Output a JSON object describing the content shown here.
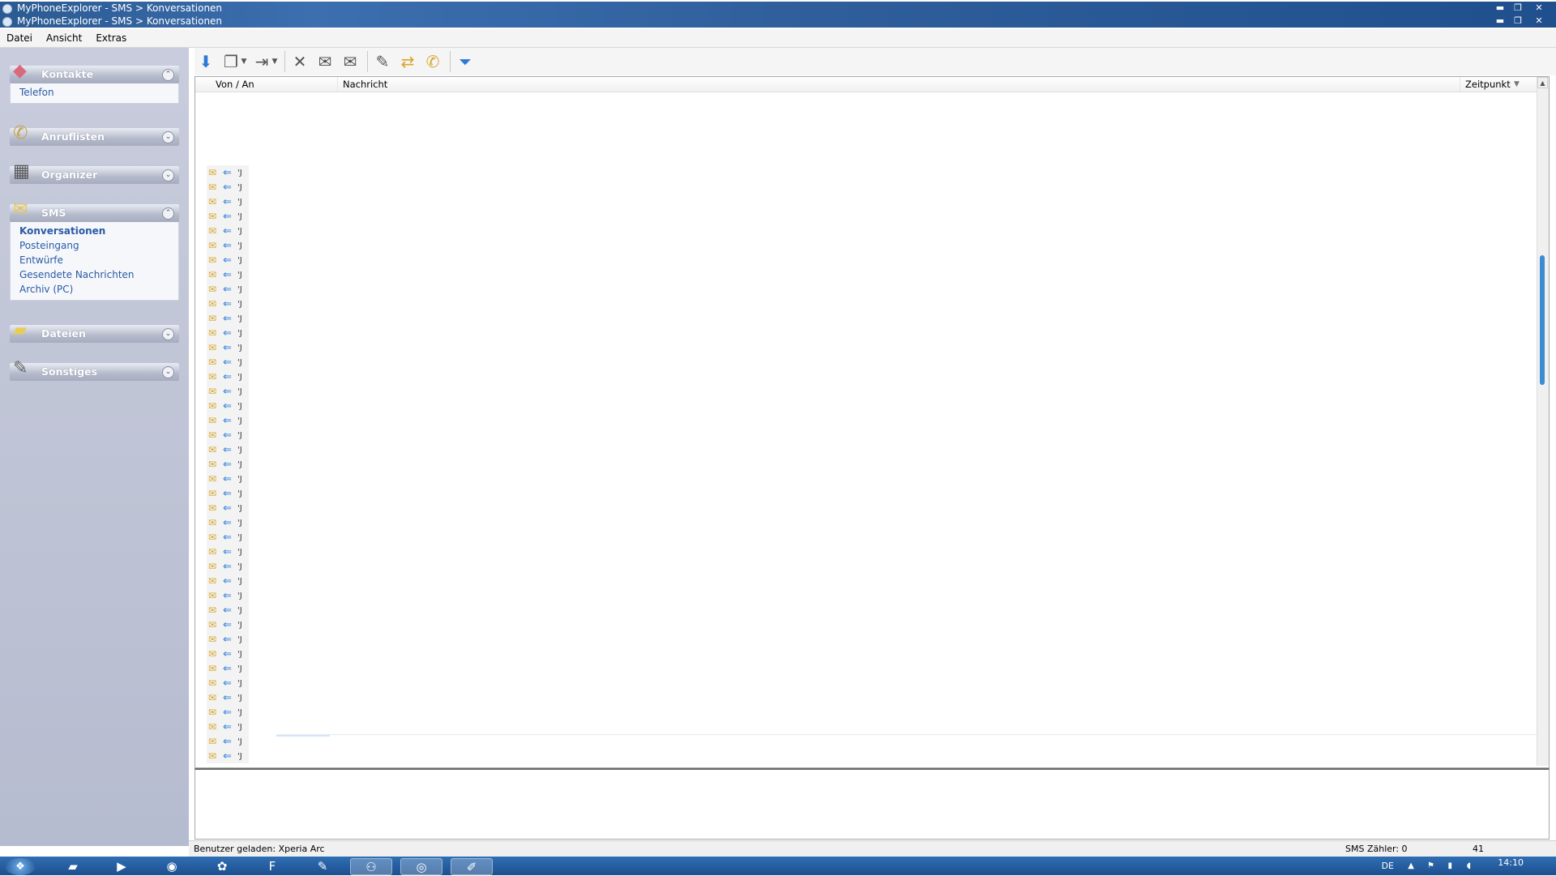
{
  "window": {
    "title_bar_1": "MyPhoneExplorer -  SMS > Konversationen",
    "title_bar_2": "MyPhoneExplorer -  SMS > Konversationen",
    "controls": {
      "minimize": "▬",
      "restore": "❐",
      "close": "✕"
    }
  },
  "menu": {
    "datei": "Datei",
    "ansicht": "Ansicht",
    "extras": "Extras"
  },
  "sidebar": {
    "kontakte": {
      "label": "Kontakte",
      "items": [
        "Telefon"
      ]
    },
    "anruflisten": {
      "label": "Anruflisten"
    },
    "organizer": {
      "label": "Organizer"
    },
    "sms": {
      "label": "SMS",
      "items": [
        "Konversationen",
        "Posteingang",
        "Entwürfe",
        "Gesendete Nachrichten",
        "Archiv (PC)"
      ]
    },
    "dateien": {
      "label": "Dateien"
    },
    "sonstiges": {
      "label": "Sonstiges"
    }
  },
  "list": {
    "columns": {
      "from_to": "Von / An",
      "message": "Nachricht",
      "time": "Zeitpunkt"
    },
    "row_marker": "'J",
    "row_count": 41
  },
  "status": {
    "user": "Benutzer geladen: Xperia Arc",
    "sms_counter": "SMS Zähler: 0",
    "count": "41"
  },
  "tray": {
    "language": "DE",
    "clock": "14:10"
  },
  "colors": {
    "link": "#2a5aa4",
    "accent": "#2b7ad8",
    "sidebar_bg": "#c8ccdc"
  }
}
